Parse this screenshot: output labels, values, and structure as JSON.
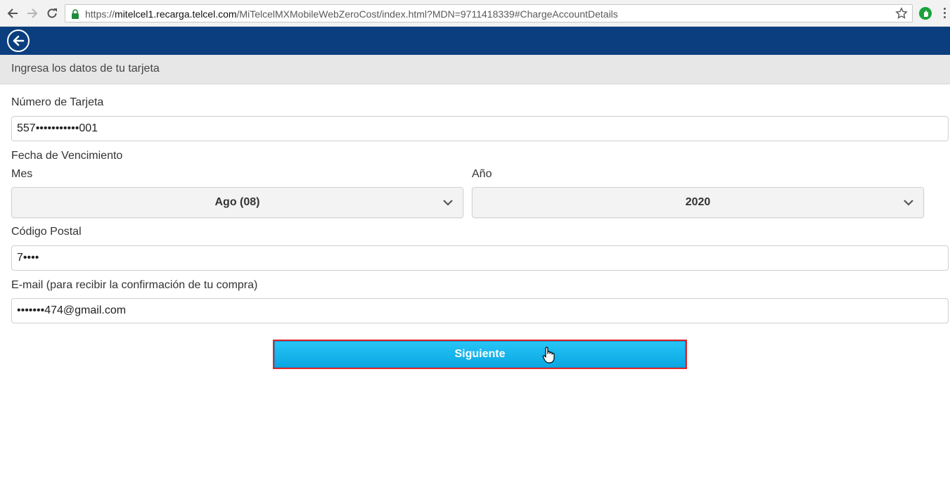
{
  "browser": {
    "url_prefix": "https://",
    "url_host": "mitelcel1.recarga.telcel.com",
    "url_path": "/MiTelcelMXMobileWebZeroCost/index.html?MDN=9711418339#ChargeAccountDetails",
    "icons": [
      "back-arrow-icon",
      "forward-arrow-icon",
      "reload-icon",
      "lock-icon",
      "star-icon",
      "extension-icon",
      "menu-dots-icon"
    ]
  },
  "header": {
    "back_icon": "circle-back-arrow-icon",
    "bg_color": "#0b3e7e"
  },
  "section": {
    "title": "Ingresa los datos de tu tarjeta"
  },
  "form": {
    "card_number_label": "Número de Tarjeta",
    "card_number_value": "557•••••••••••001",
    "expiry_label": "Fecha de Vencimiento",
    "month_label": "Mes",
    "month_value": "Ago (08)",
    "year_label": "Año",
    "year_value": "2020",
    "postal_label": "Código Postal",
    "postal_value": "7••••",
    "email_label": "E-mail (para recibir la confirmación de tu compra)",
    "email_value": "•••••••474@gmail.com",
    "submit_label": "Siguiente",
    "submit_color": "#1bb6ee",
    "highlight_color": "#e0242b"
  }
}
